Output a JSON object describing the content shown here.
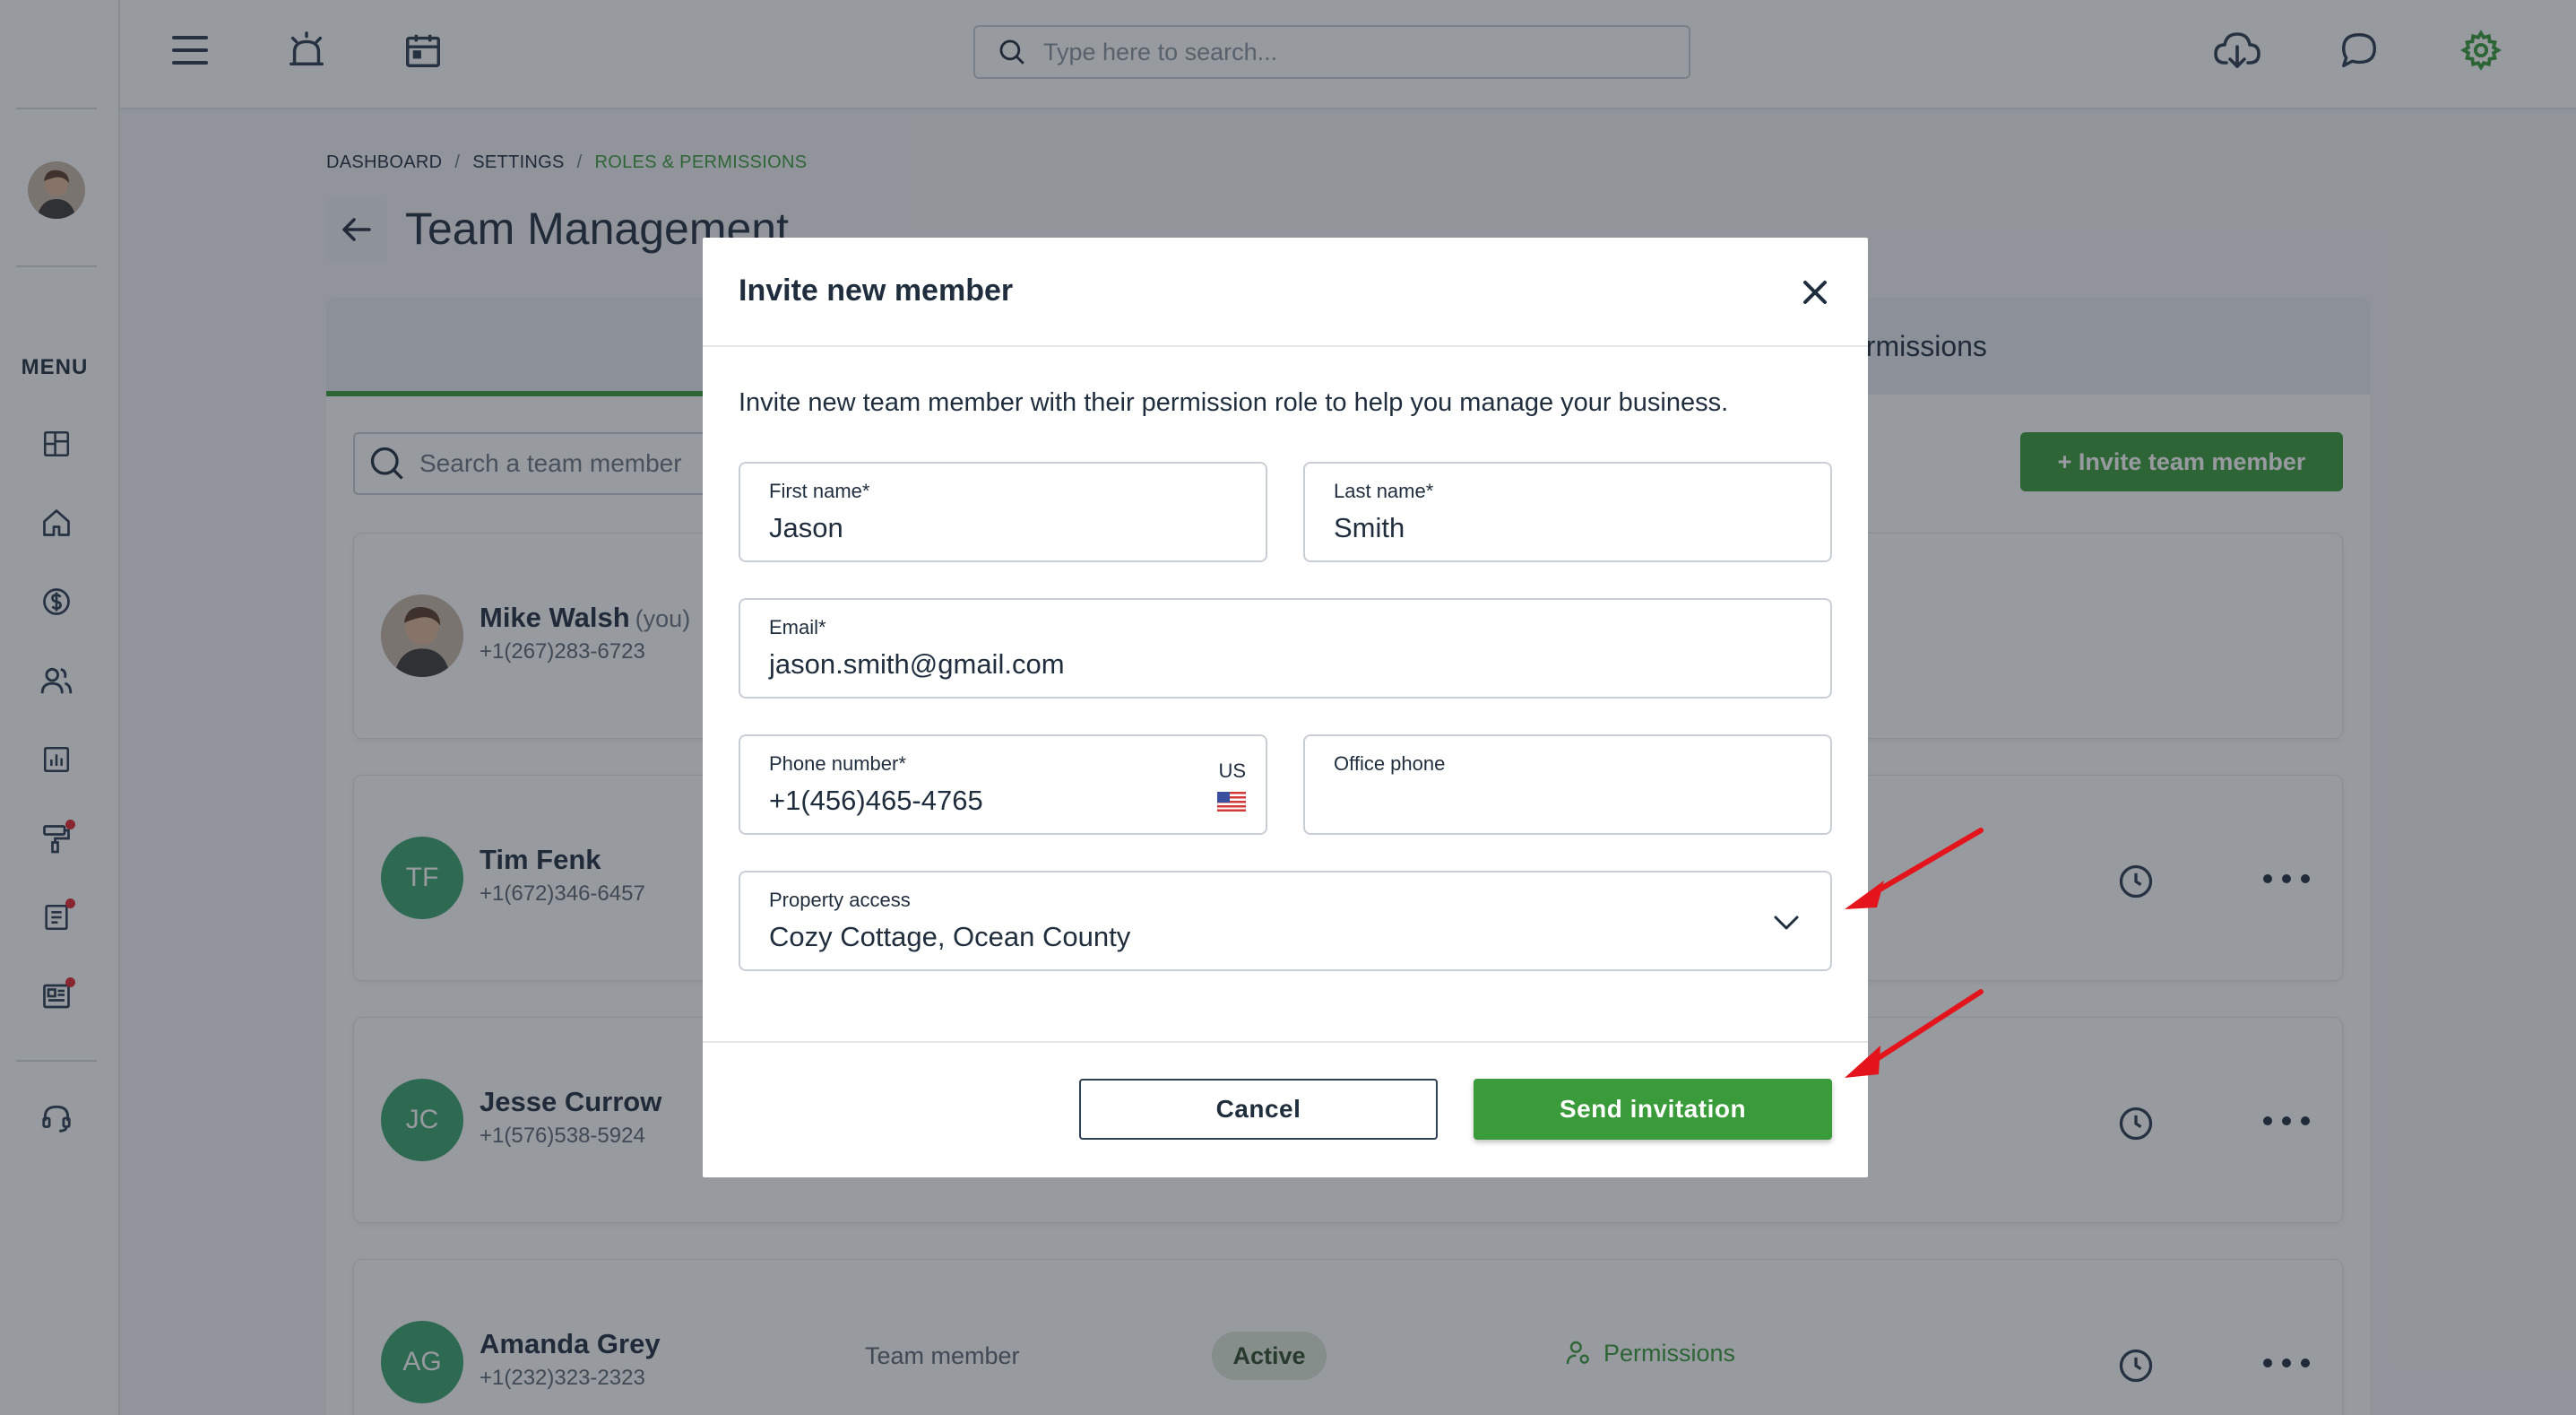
{
  "topbar": {
    "search_placeholder": "Type here to search...",
    "icons": [
      "menu-icon",
      "alarm-icon",
      "calendar-icon",
      "cloud-download-icon",
      "chat-icon",
      "settings-icon"
    ]
  },
  "sidebar": {
    "menu_label": "MENU",
    "items": [
      "dashboard-icon",
      "home-icon",
      "dollar-icon",
      "users-icon",
      "chart-icon",
      "paint-roller-icon",
      "document-icon",
      "newspaper-icon",
      "support-icon"
    ]
  },
  "breadcrumb": {
    "items": [
      "DASHBOARD",
      "SETTINGS",
      "ROLES & PERMISSIONS"
    ],
    "separator": "/"
  },
  "page": {
    "title": "Team Management",
    "tab_permissions_partial": "ermissions",
    "search_member_placeholder": "Search a team member",
    "invite_button": "+ Invite team member"
  },
  "members": [
    {
      "name": "Mike Walsh",
      "you_tag": "(you)",
      "phone": "+1(267)283-6723",
      "initials": ""
    },
    {
      "name": "Tim Fenk",
      "phone": "+1(672)346-6457",
      "initials": "TF"
    },
    {
      "name": "Jesse Currow",
      "phone": "+1(576)538-5924",
      "initials": "JC"
    },
    {
      "name": "Amanda Grey",
      "phone": "+1(232)323-2323",
      "initials": "AG",
      "role": "Team member",
      "status": "Active",
      "permissions": "Permissions"
    }
  ],
  "modal": {
    "title": "Invite new member",
    "description": "Invite new team member with their permission role to help you manage your business.",
    "fields": {
      "first_name": {
        "label": "First name*",
        "value": "Jason"
      },
      "last_name": {
        "label": "Last name*",
        "value": "Smith"
      },
      "email": {
        "label": "Email*",
        "value": "jason.smith@gmail.com"
      },
      "phone": {
        "label": "Phone number*",
        "value": "+1(456)465-4765",
        "country": "US"
      },
      "office_phone": {
        "label": "Office phone",
        "value": ""
      },
      "property_access": {
        "label": "Property access",
        "value": "Cozy Cottage, Ocean County"
      }
    },
    "cancel_button": "Cancel",
    "send_button": "Send invitation"
  },
  "colors": {
    "accent_green": "#3a9b3a",
    "annotation_red": "#e3141b",
    "overlay": "rgba(33,40,50,0.47)"
  }
}
